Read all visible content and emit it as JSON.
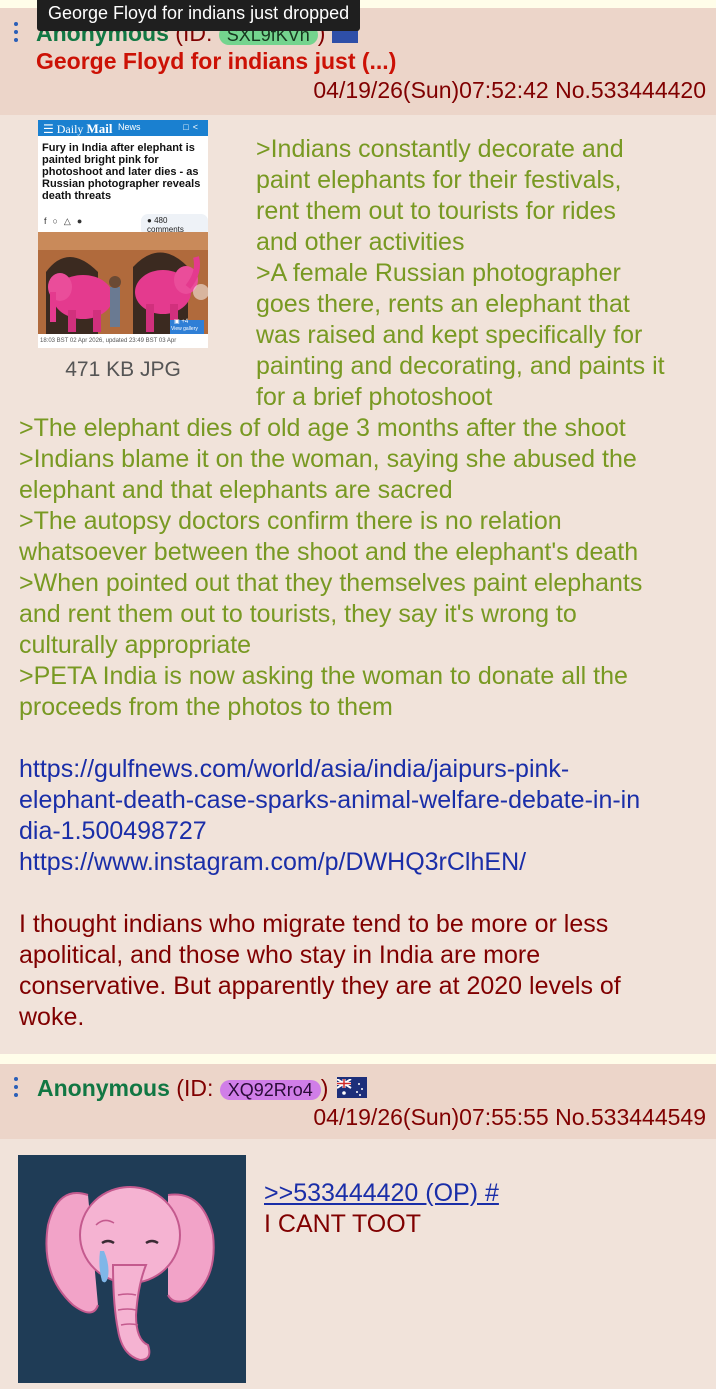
{
  "tooltip": "George Floyd for indians just dropped",
  "op": {
    "name": "Anonymous",
    "id_prefix": "(ID:",
    "id": "SXL9fKVn",
    "id_suffix": ") ",
    "subject": "George Floyd for indians just (...)",
    "date": "04/19/26(Sun)07:52:42",
    "number": "No.533444420",
    "file_info": "471 KB JPG",
    "thumbnail": {
      "brand_daily": "Daily",
      "brand_mail": "Mail",
      "section": "News",
      "headline": "Fury in India after elephant is painted bright pink for photoshoot and later dies - as Russian photographer reveals death threats",
      "comments": "480 comments",
      "gallery_count": "+4",
      "gallery_label": "View gallery",
      "caption": "18:03 BST 02 Apr 2026, updated 23:49 BST 03 Apr"
    },
    "text_lines_right": [
      ">Indians constantly decorate and",
      "paint elephants for their festivals,",
      "rent them out to tourists for rides",
      "and other activities",
      ">A female Russian photographer",
      "goes there, rents an elephant that",
      "was raised and kept specifically for",
      "painting and decorating, and paints it",
      "for a brief photoshoot"
    ],
    "text_lines_full": [
      ">The elephant dies of old age 3 months after the shoot",
      ">Indians blame it on the woman, saying she abused the",
      "elephant and that elephants are sacred",
      ">The autopsy doctors confirm there is no relation",
      "whatsoever between the shoot and the elephant's death",
      ">When pointed out that they themselves paint elephants",
      "and rent them out to tourists, they say it's wrong to",
      "culturally appropriate",
      ">PETA India is now asking the woman to donate all the",
      "proceeds from the photos to them"
    ],
    "link_lines": [
      "https://gulfnews.com/world/asia/india/jaipurs-pink-",
      "elephant-death-case-sparks-animal-welfare-debate-in-in",
      "dia-1.500498727",
      "https://www.instagram.com/p/DWHQ3rClhEN/"
    ],
    "body_lines": [
      "I thought indians who migrate tend to be more or less",
      "apolitical, and those who stay in India are more",
      "conservative. But apparently they are at 2020 levels of",
      "woke."
    ]
  },
  "reply": {
    "name": "Anonymous",
    "id_prefix": "(ID: ",
    "id": "XQ92Rro4",
    "id_suffix": ")",
    "flag": "Australia",
    "date": "04/19/26(Sun)07:55:55",
    "number": "No.533444549",
    "quote_link": ">>533444420 (OP) #",
    "text": "I CANT TOOT"
  },
  "colors": {
    "post_bg": "#f1e3da",
    "header_bg": "#ecd5c9",
    "greentext": "#789922",
    "name": "#117743",
    "subject": "#cc1105",
    "link": "#1a2ea8",
    "body": "#800000"
  }
}
